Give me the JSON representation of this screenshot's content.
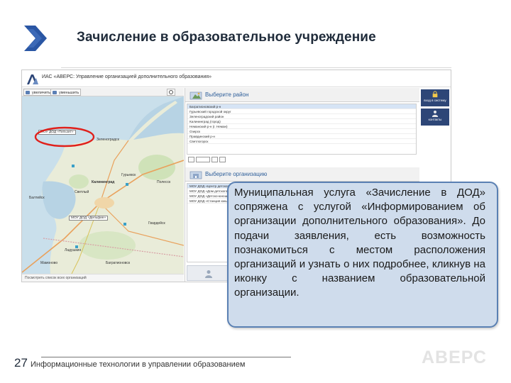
{
  "slide": {
    "title": "Зачисление в образовательное учреждение",
    "page_number": "27",
    "footer": "Информационные технологии в управлении образованием",
    "brand": "АВЕРС",
    "accent_color": "#2a56a4"
  },
  "app": {
    "title": "ИАС «АВЕРС: Управление организацией дополнительного образования»",
    "toolbar": {
      "btn1": "увеличить",
      "btn2": "уменьшить"
    },
    "map": {
      "labels": [
        "Зеленоградск",
        "Калининград",
        "Гурьевск",
        "Балтийск",
        "Светлый",
        "Полесск",
        "Гвардейск",
        "Ладушкин",
        "Мамоново",
        "Багратионовск"
      ],
      "highlight_label": "МОУ ДОД «Тильзит»",
      "popup_label": "МОУ ДОД «Дельфин»",
      "bottom_text": "Посмотреть список всех организаций"
    },
    "district_section": {
      "heading": "Выберите район",
      "items": [
        "Багратионовский р-н",
        "Гурьевский городской округ",
        "Зеленоградский район",
        "Калининград (город)",
        "Неманский р-н (г. Неман)",
        "Озерск",
        "Правдинский р-н",
        "Светлогорск"
      ],
      "selected_index": 0
    },
    "org_section": {
      "heading": "Выберите организацию",
      "items": [
        "МОУ ДОД «Центр детского творчества»",
        "МОУ ДОД «Дом детского творчества»",
        "МОУ ДОД «Детско-юношеская спортивная школа»",
        "МОУ ДОД «Станция юных натуралистов»"
      ],
      "selected_index": 0
    },
    "side_buttons": {
      "login": "вход в систему",
      "contacts": "контакты"
    }
  },
  "callout": {
    "text": "Муниципальная услуга «Зачисление в ДОД» сопряжена с услугой «Информированием об организации дополнительного образования». До подачи заявления, есть возможность познакомиться с местом расположения организаций и узнать о них подробнее, кликнув на иконку с названием образовательной организации."
  }
}
